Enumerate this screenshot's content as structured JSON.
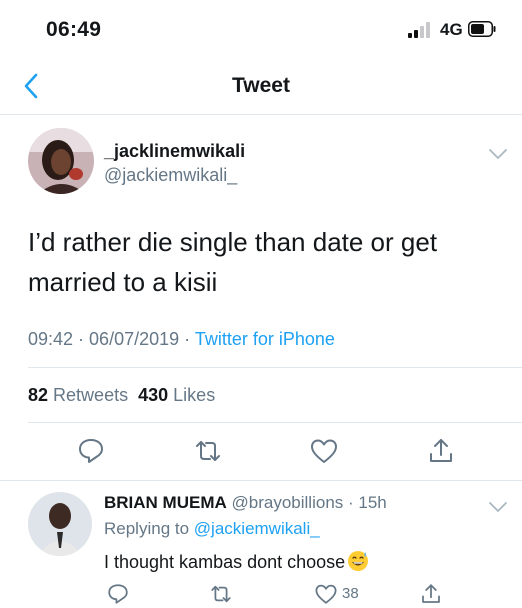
{
  "status_bar": {
    "time": "06:49",
    "network": "4G"
  },
  "nav": {
    "title": "Tweet"
  },
  "tweet": {
    "author_name": "_jacklinemwikali",
    "author_handle": "@jackiemwikali_",
    "text": "I’d rather die single than date or get married to a kisii",
    "time": "09:42",
    "date": "06/07/2019",
    "source": "Twitter for iPhone",
    "retweets_count": "82",
    "retweets_label": "Retweets",
    "likes_count": "430",
    "likes_label": "Likes"
  },
  "reply": {
    "author_name": "BRIAN MUEMA",
    "author_handle": "@brayobillions",
    "age": "15h",
    "replying_prefix": "Replying to",
    "replying_to": "@jackiemwikali_",
    "text": "I thought kambas dont choose",
    "like_count": "38"
  },
  "colors": {
    "accent": "#1da1f2",
    "secondary_text": "#657786",
    "divider": "#e1e8ed",
    "icon": "#657786"
  },
  "icons": [
    "chevron-left-icon",
    "chevron-down-icon",
    "reply-icon",
    "retweet-icon",
    "like-icon",
    "share-icon",
    "signal-icon",
    "battery-icon",
    "grinning-sweat-emoji-icon"
  ]
}
